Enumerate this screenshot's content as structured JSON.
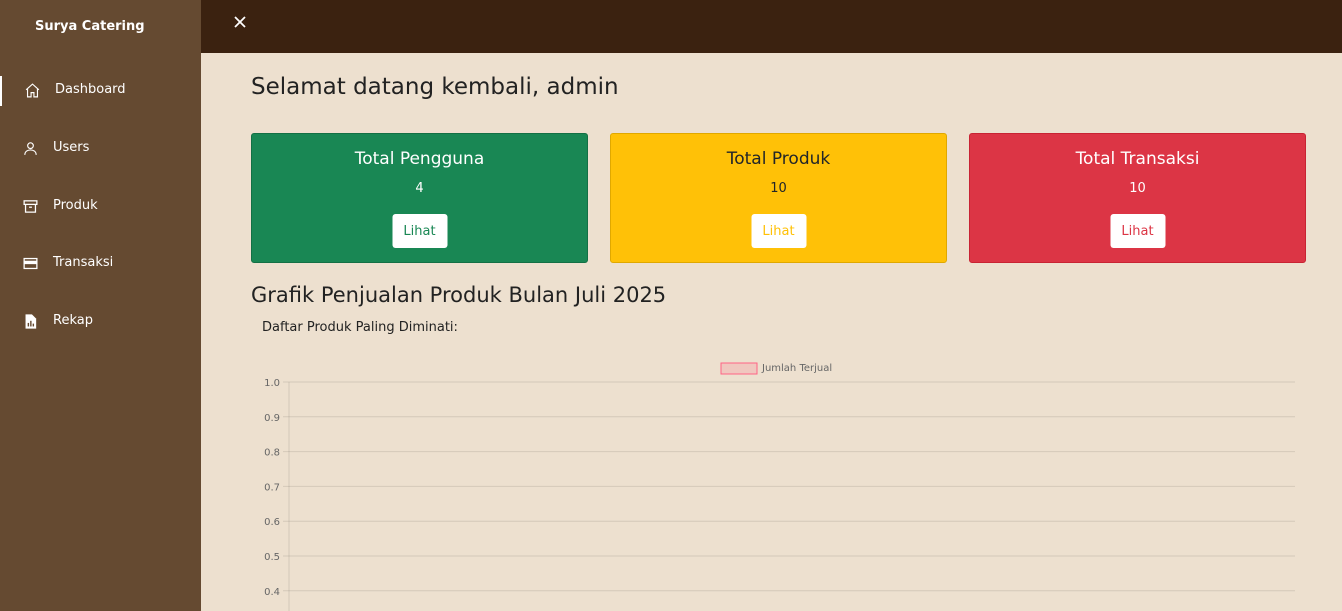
{
  "app": {
    "brand": "Surya Catering"
  },
  "sidebar": {
    "items": [
      {
        "label": "Dashboard",
        "icon": "home-icon",
        "active": true
      },
      {
        "label": "Users",
        "icon": "user-icon"
      },
      {
        "label": "Produk",
        "icon": "archive-icon"
      },
      {
        "label": "Transaksi",
        "icon": "credit-card-icon"
      },
      {
        "label": "Rekap",
        "icon": "file-chart-icon"
      }
    ]
  },
  "topbar": {
    "close_icon": "close-icon"
  },
  "main": {
    "welcome": "Selamat datang kembali, admin",
    "cards": [
      {
        "title": "Total Pengguna",
        "value": "4",
        "button": "Lihat",
        "color": "#198754"
      },
      {
        "title": "Total Produk",
        "value": "10",
        "button": "Lihat",
        "color": "#ffc107"
      },
      {
        "title": "Total Transaksi",
        "value": "10",
        "button": "Lihat",
        "color": "#dc3545"
      }
    ],
    "section_title": "Grafik Penjualan Produk Bulan Juli 2025",
    "subtitle": "Daftar Produk Paling Diminati:"
  },
  "chart_data": {
    "type": "bar",
    "categories": [],
    "series": [
      {
        "name": "Jumlah Terjual",
        "values": [],
        "color": "#ff6384"
      }
    ],
    "legend": "top-center",
    "ylim": [
      0,
      1.0
    ],
    "yticks": [
      "1.0",
      "0.9",
      "0.8",
      "0.7",
      "0.6",
      "0.5",
      "0.4"
    ],
    "grid": true
  }
}
